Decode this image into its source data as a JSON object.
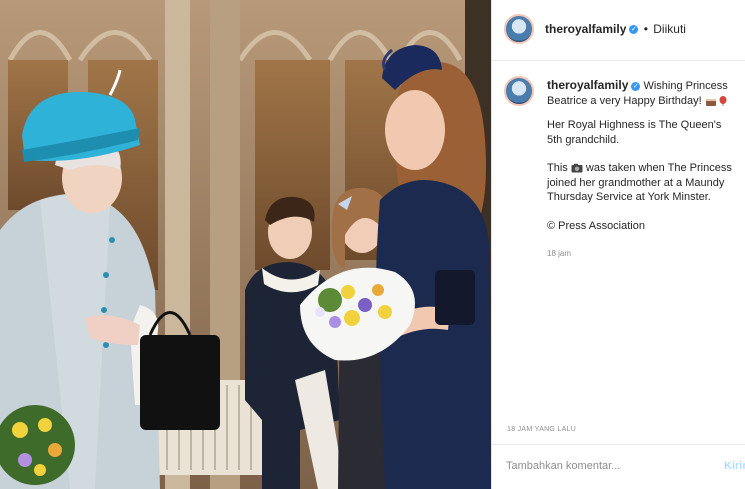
{
  "header": {
    "username": "theroyalfamily",
    "separator": "•",
    "follow_status": "Diikuti"
  },
  "caption": {
    "username": "theroyalfamily",
    "line1": "Wishing Princess Beatrice a very Happy Birthday!",
    "line2": "Her Royal Highness is The Queen's 5th grandchild.",
    "line3_pre": "This",
    "line3_post": "was taken when The Princess joined her grandmother at a Maundy Thursday Service at York Minster.",
    "line4": "© Press Association",
    "time": "18 jam"
  },
  "footer": {
    "ago": "18 JAM YANG LALU",
    "comment_placeholder": "Tambahkan komentar...",
    "post_label": "Kirim"
  },
  "icons": [
    "avatar",
    "verified-badge-icon",
    "cake-emoji-icon",
    "balloon-emoji-icon",
    "camera-emoji-icon"
  ],
  "colors": {
    "verified": "#3897f0",
    "username": "#262626",
    "meta": "#8e8e8e",
    "post_disabled": "#b2dffc"
  }
}
